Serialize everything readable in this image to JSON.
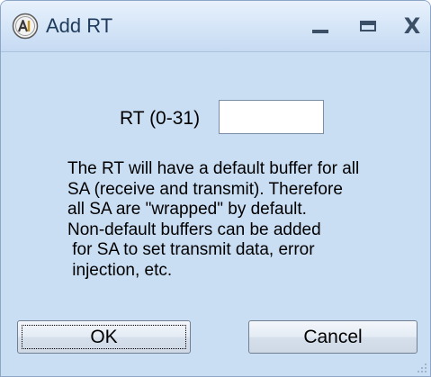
{
  "window": {
    "title": "Add RT",
    "icon": "app-logo-icon",
    "controls": {
      "minimize_icon": "minimize-icon",
      "maximize_icon": "maximize-icon",
      "close_glyph": "X"
    }
  },
  "form": {
    "rt_label": "RT (0-31)",
    "rt_value": ""
  },
  "description": {
    "lines": [
      "The RT will have a default buffer for all",
      "SA (receive and transmit).  Therefore",
      "all SA are \"wrapped\" by default.",
      "Non-default buffers can be added",
      " for SA to set transmit data, error",
      " injection, etc."
    ]
  },
  "buttons": {
    "ok_label": "OK",
    "cancel_label": "Cancel"
  },
  "colors": {
    "client_background": "#c9ddf3",
    "title_text": "#1f3b5b"
  }
}
